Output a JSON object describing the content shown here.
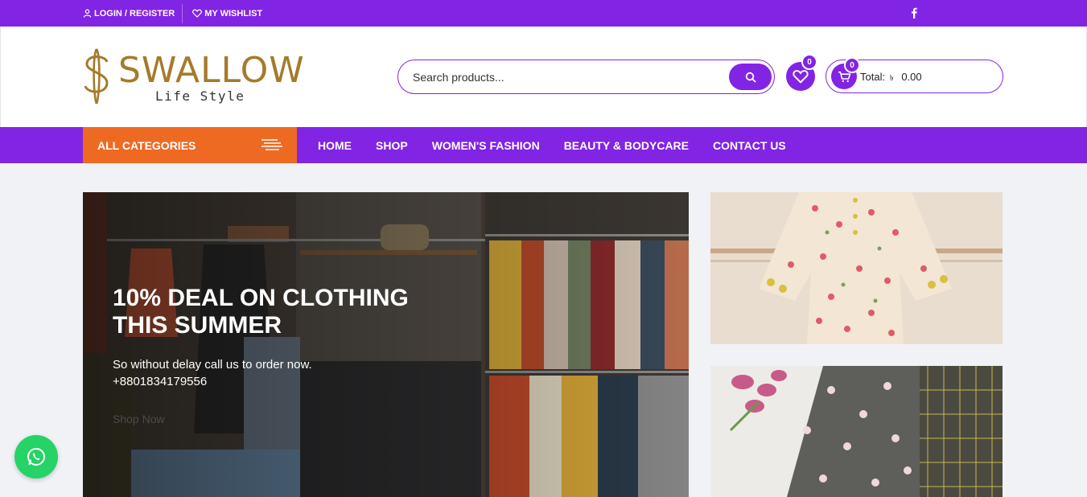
{
  "topbar": {
    "login_label": "LOGIN / REGISTER",
    "wishlist_label": "MY WISHLIST",
    "social_icon": "facebook-icon"
  },
  "header": {
    "logo_word": "SWALLOW",
    "logo_tagline": "Life Style",
    "search_placeholder": "Search products...",
    "wishlist_count": "0",
    "cart_count": "0",
    "cart_total_label": "Total:",
    "currency_symbol": "৳",
    "cart_total_value": "0.00"
  },
  "nav": {
    "all_categories": "ALL CATEGORIES",
    "items": [
      {
        "label": "HOME"
      },
      {
        "label": "SHOP"
      },
      {
        "label": "WOMEN'S FASHION"
      },
      {
        "label": "BEAUTY & BODYCARE"
      },
      {
        "label": "CONTACT US"
      }
    ]
  },
  "hero": {
    "headline": "10% DEAL ON CLOTHING THIS SUMMER",
    "subtext": "So without delay call us to order now. +8801834179556",
    "cta": "Shop Now"
  },
  "colors": {
    "brand_purple": "#8224e3",
    "category_orange": "#ee6a23",
    "whatsapp_green": "#25d366",
    "logo_gold": "#a57a2a"
  }
}
